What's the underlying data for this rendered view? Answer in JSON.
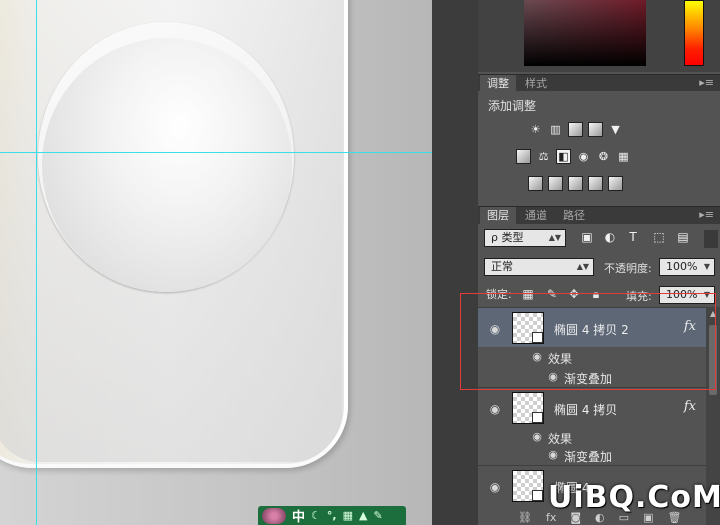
{
  "adjustments_panel": {
    "tabs": [
      "调整",
      "样式"
    ],
    "title": "添加调整"
  },
  "layers_panel": {
    "tabs": [
      "图层",
      "通道",
      "路径"
    ],
    "filter_select": "ρ 类型",
    "blend_mode": "正常",
    "opacity_label": "不透明度:",
    "opacity_value": "100%",
    "lock_label": "锁定:",
    "fill_label": "填充:",
    "fill_value": "100%",
    "layers": [
      {
        "name": "椭圆 4 拷贝 2",
        "selected": true,
        "effects_label": "效果",
        "effect": "渐变叠加"
      },
      {
        "name": "椭圆 4 拷贝",
        "selected": false,
        "effects_label": "效果",
        "effect": "渐变叠加"
      },
      {
        "name": "椭圆 4",
        "selected": false
      }
    ]
  },
  "watermark": {
    "text": "UiBQ.CoM"
  },
  "colors": {
    "guide": "#37e0e6",
    "selected_layer": "#5d6776",
    "annotation": "#e23b3b",
    "panel_bg": "#535353",
    "hue": "#ff0000"
  },
  "icons": [
    "brightness-icon",
    "levels-icon",
    "curves-icon",
    "exposure-icon",
    "vibrance-icon",
    "hue-saturation-icon",
    "color-balance-icon",
    "black-white-icon",
    "photo-filter-icon",
    "channel-mixer-icon",
    "color-lookup-icon",
    "invert-icon",
    "posterize-icon",
    "threshold-icon",
    "selective-color-icon",
    "gradient-map-icon",
    "eye-icon",
    "fx-icon",
    "lock-icon"
  ]
}
